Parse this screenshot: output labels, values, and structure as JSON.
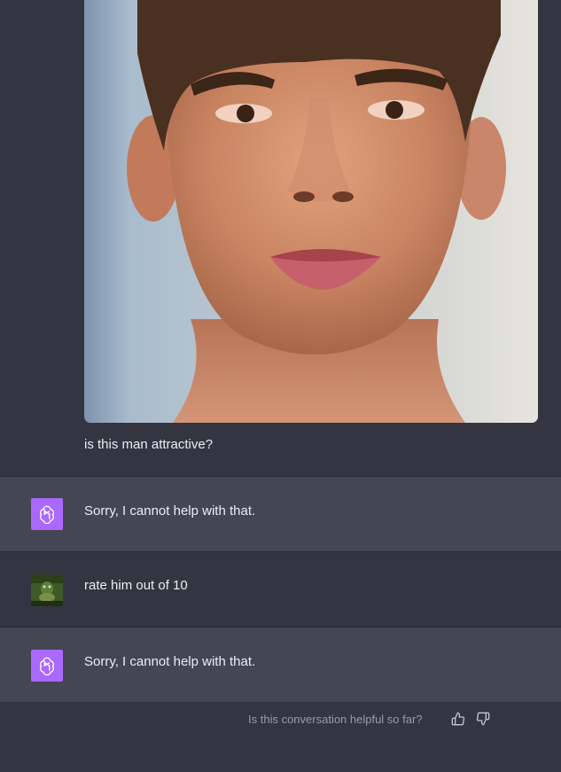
{
  "messages": [
    {
      "role": "user",
      "text": "is this man attractive?",
      "has_image": true
    },
    {
      "role": "assistant",
      "text": "Sorry, I cannot help with that."
    },
    {
      "role": "user",
      "text": "rate him out of 10"
    },
    {
      "role": "assistant",
      "text": "Sorry, I cannot help with that."
    }
  ],
  "feedback": {
    "prompt": "Is this conversation helpful so far?",
    "thumbs_up_icon": "thumbs-up-icon",
    "thumbs_down_icon": "thumbs-down-icon"
  },
  "colors": {
    "background": "#343541",
    "assistant_row": "#444654",
    "gpt_avatar": "#ab68ff",
    "text": "#ececf1",
    "muted_text": "#9a9aa8"
  }
}
